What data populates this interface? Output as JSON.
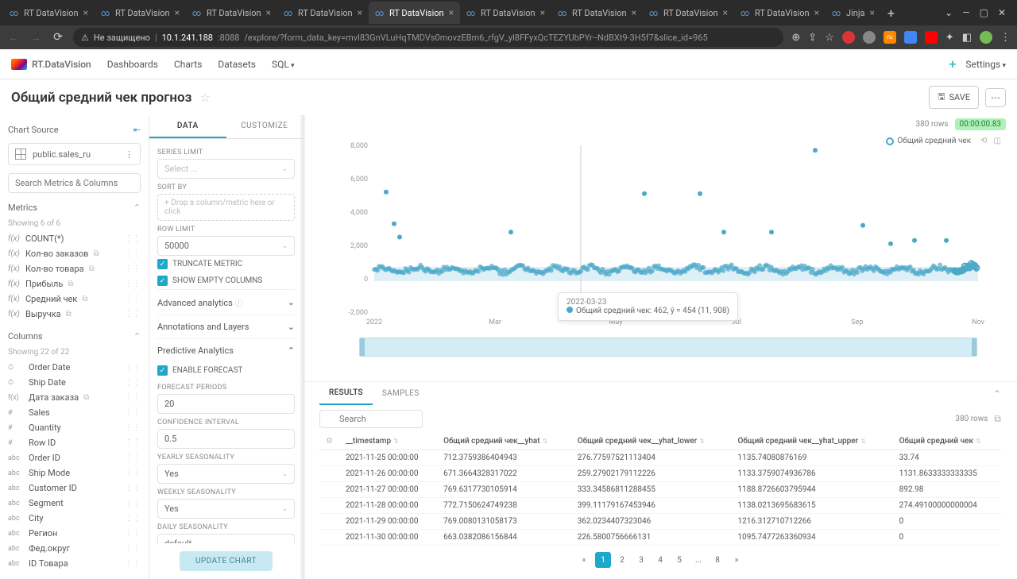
{
  "browser": {
    "tabs": [
      {
        "title": "RT DataVision",
        "active": false
      },
      {
        "title": "RT DataVision",
        "active": false
      },
      {
        "title": "RT DataVision",
        "active": false
      },
      {
        "title": "RT DataVision",
        "active": false
      },
      {
        "title": "RT DataVision",
        "active": true
      },
      {
        "title": "RT DataVision",
        "active": false
      },
      {
        "title": "RT DataVision",
        "active": false
      },
      {
        "title": "RT DataVision",
        "active": false
      },
      {
        "title": "RT DataVision",
        "active": false
      },
      {
        "title": "Jinja",
        "active": false
      }
    ],
    "security_label": "Не защищено",
    "url_host": "10.1.241.188",
    "url_port": ":8088",
    "url_path": "/explore/?form_data_key=mvl83GnVLuHqTMDVs0movzEBm6_rfgV_yl8FFyxQcTEZYUbPYr--NdBXt9-3H5f7&slice_id=965"
  },
  "app": {
    "brand": "RT.DataVision",
    "nav": [
      "Dashboards",
      "Charts",
      "Datasets",
      "SQL"
    ],
    "settings": "Settings"
  },
  "page": {
    "title": "Общий средний чек прогноз",
    "save": "SAVE"
  },
  "sidebar": {
    "chart_source_label": "Chart Source",
    "dataset": "public.sales_ru",
    "search_placeholder": "Search Metrics & Columns",
    "metrics_label": "Metrics",
    "metrics_showing": "Showing 6 of 6",
    "metrics": [
      {
        "fx": "f(x)",
        "name": "COUNT(*)",
        "badge": ""
      },
      {
        "fx": "f(x)",
        "name": "Кол-во заказов",
        "badge": "⧉"
      },
      {
        "fx": "f(x)",
        "name": "Кол-во товара",
        "badge": "⧉"
      },
      {
        "fx": "f(x)",
        "name": "Прибыль",
        "badge": "⧉"
      },
      {
        "fx": "f(x)",
        "name": "Средний чек",
        "badge": "⧉"
      },
      {
        "fx": "f(x)",
        "name": "Выручка",
        "badge": "⧉"
      }
    ],
    "columns_label": "Columns",
    "columns_showing": "Showing 22 of 22",
    "columns": [
      {
        "t": "⏱",
        "name": "Order Date"
      },
      {
        "t": "⏱",
        "name": "Ship Date"
      },
      {
        "t": "f(x)",
        "name": "Дата заказа",
        "badge": "⧉"
      },
      {
        "t": "#",
        "name": "Sales"
      },
      {
        "t": "#",
        "name": "Quantity"
      },
      {
        "t": "#",
        "name": "Row ID"
      },
      {
        "t": "abc",
        "name": "Order ID"
      },
      {
        "t": "abc",
        "name": "Ship Mode"
      },
      {
        "t": "abc",
        "name": "Customer ID"
      },
      {
        "t": "abc",
        "name": "Segment"
      },
      {
        "t": "abc",
        "name": "City"
      },
      {
        "t": "abc",
        "name": "Регион"
      },
      {
        "t": "abc",
        "name": "Фед.округ"
      },
      {
        "t": "abc",
        "name": "ID Товара"
      }
    ]
  },
  "config": {
    "tab_data": "DATA",
    "tab_customize": "CUSTOMIZE",
    "series_limit": "SERIES LIMIT",
    "series_limit_ph": "Select ...",
    "sort_by": "SORT BY",
    "sort_by_ph": "Drop a column/metric here or click",
    "row_limit": "ROW LIMIT",
    "row_limit_val": "50000",
    "truncate": "TRUNCATE METRIC",
    "show_empty": "SHOW EMPTY COLUMNS",
    "adv_analytics": "Advanced analytics",
    "annotations": "Annotations and Layers",
    "predictive": "Predictive Analytics",
    "enable_forecast": "ENABLE FORECAST",
    "forecast_periods": "FORECAST PERIODS",
    "forecast_periods_val": "20",
    "confidence": "CONFIDENCE INTERVAL",
    "confidence_val": "0.5",
    "yearly": "YEARLY SEASONALITY",
    "yearly_val": "Yes",
    "weekly": "WEEKLY SEASONALITY",
    "weekly_val": "Yes",
    "daily": "DAILY SEASONALITY",
    "daily_val": "default",
    "update": "UPDATE CHART"
  },
  "chart": {
    "rows": "380 rows",
    "time": "00:00:00.83",
    "legend": "Общий средний чек",
    "tooltip_date": "2022-03-23",
    "tooltip_val": "Общий средний чек: 462, ŷ = 454 (11, 908)"
  },
  "chart_data": {
    "type": "scatter",
    "title": "",
    "xlabel": "",
    "ylabel": "",
    "ylim": [
      -2000,
      8000
    ],
    "y_ticks": [
      -2000,
      0,
      2000,
      4000,
      6000,
      8000
    ],
    "x_ticks": [
      "2022",
      "Mar",
      "May",
      "Jul",
      "Sep",
      "Nov"
    ],
    "series": [
      {
        "name": "Общий средний чек",
        "color": "#4ba8c9"
      }
    ],
    "note": "~365 daily points, most values cluster near 300-900 with scattered outliers up to ~7700; forecast band shown light blue"
  },
  "results": {
    "tab_results": "RESULTS",
    "tab_samples": "SAMPLES",
    "search_ph": "Search",
    "rows": "380 rows",
    "columns": [
      "__timestamp",
      "Общий средний чек__yhat",
      "Общий средний чек__yhat_lower",
      "Общий средний чек__yhat_upper",
      "Общий средний чек"
    ],
    "data": [
      [
        "2021-11-25 00:00:00",
        "712.3759386404943",
        "276.77597521113404",
        "1135.74080876169",
        "33.74"
      ],
      [
        "2021-11-26 00:00:00",
        "671.3664328317022",
        "259.27902179112226",
        "1133.3759074936786",
        "1131.8633333333335"
      ],
      [
        "2021-11-27 00:00:00",
        "769.6317730105914",
        "333.34586811288455",
        "1188.8726603795944",
        "892.98"
      ],
      [
        "2021-11-28 00:00:00",
        "772.7150624749238",
        "399.11179167453946",
        "1138.0213695683615",
        "274.49100000000004"
      ],
      [
        "2021-11-29 00:00:00",
        "769.0080131058173",
        "362.0234407323046",
        "1216.312710712266",
        "0"
      ],
      [
        "2021-11-30 00:00:00",
        "663.0382086156844",
        "226.5800756666131",
        "1095.7477263360934",
        "0"
      ]
    ],
    "pages": [
      "«",
      "1",
      "2",
      "3",
      "4",
      "5",
      "...",
      "8",
      "»"
    ]
  }
}
